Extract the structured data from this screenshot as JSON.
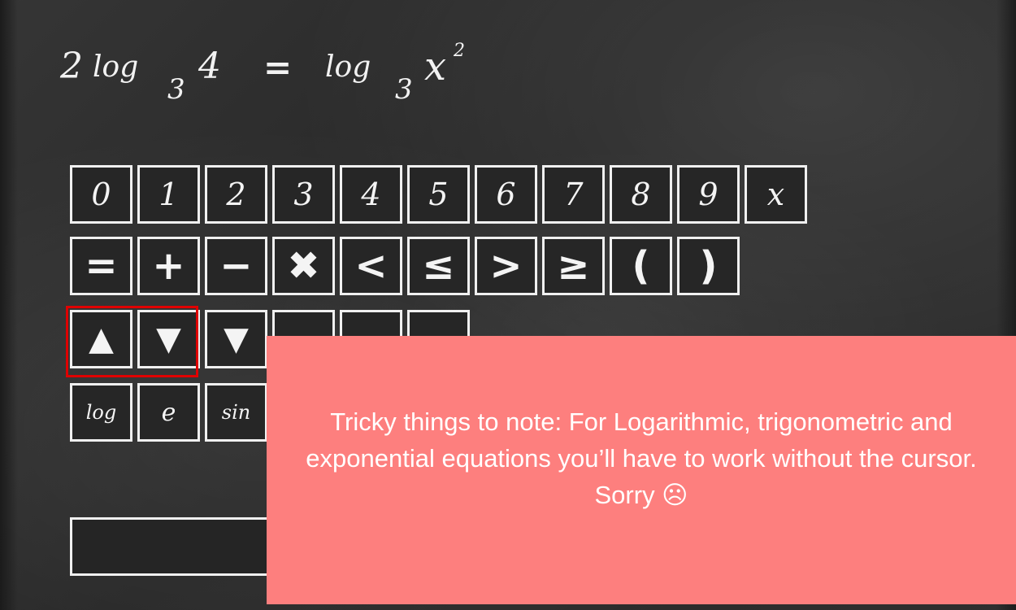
{
  "equation": {
    "coefficient": "2",
    "log_left": "log",
    "base_left": "3",
    "argument": "4",
    "equals": "=",
    "log_right": "log",
    "base_right": "3",
    "variable": "x",
    "exponent": "2"
  },
  "keypad": {
    "digits": [
      "0",
      "1",
      "2",
      "3",
      "4",
      "5",
      "6",
      "7",
      "8",
      "9",
      "x"
    ],
    "operators": [
      "=",
      "+",
      "−",
      "✖",
      "<",
      "≤",
      ">",
      "≥",
      "(",
      ")"
    ],
    "cursor_keys": [
      "▲",
      "▼",
      "▼"
    ],
    "functions": [
      "log",
      "e",
      "sin"
    ]
  },
  "note": {
    "text": "Tricky things to note: For Logarithmic, trigonometric and exponential equations you’ll have to work without the cursor. Sorry ☹"
  },
  "colors": {
    "board": "#2b2b2b",
    "chalk": "#f0f0f0",
    "highlight": "#e00000",
    "note_background": "#fd7f7e"
  }
}
